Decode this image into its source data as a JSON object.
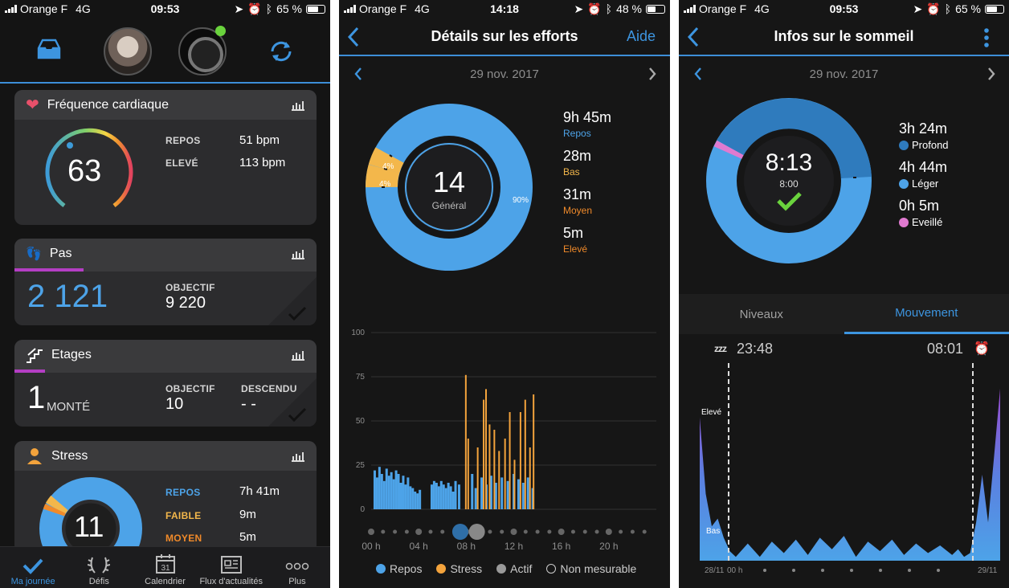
{
  "status": [
    {
      "carrier": "Orange F",
      "network": "4G",
      "time": "09:53",
      "battery": "65 %",
      "battery_level": 0.65
    },
    {
      "carrier": "Orange F",
      "network": "4G",
      "time": "14:18",
      "battery": "48 %",
      "battery_level": 0.48
    },
    {
      "carrier": "Orange F",
      "network": "4G",
      "time": "09:53",
      "battery": "65 %",
      "battery_level": 0.65
    }
  ],
  "day": {
    "heart": {
      "title": "Fréquence cardiaque",
      "value": "63",
      "rest_label": "REPOS",
      "rest_value": "51 bpm",
      "high_label": "ELEVÉ",
      "high_value": "113 bpm"
    },
    "steps": {
      "title": "Pas",
      "value": "2 121",
      "goal_label": "OBJECTIF",
      "goal_value": "9 220",
      "progress": 0.23
    },
    "floors": {
      "title": "Etages",
      "value": "1",
      "value_suffix": "MONTÉ",
      "goal_label": "OBJECTIF",
      "goal_value": "10",
      "down_label": "DESCENDU",
      "down_value": "- -",
      "progress": 0.1
    },
    "stress": {
      "title": "Stress",
      "value": "11",
      "rows": [
        {
          "label": "REPOS",
          "value": "7h 41m",
          "color": "#4da3e8"
        },
        {
          "label": "FAIBLE",
          "value": "9m",
          "color": "#f3b74b"
        },
        {
          "label": "MOYEN",
          "value": "5m",
          "color": "#f08a2a"
        }
      ]
    },
    "tabs": [
      {
        "label": "Ma journée",
        "icon": "check-icon"
      },
      {
        "label": "Défis",
        "icon": "laurel-icon"
      },
      {
        "label": "Calendrier",
        "icon": "calendar-icon",
        "day_number": "31"
      },
      {
        "label": "Flux d'actualités",
        "icon": "newsfeed-icon"
      },
      {
        "label": "Plus",
        "icon": "more-icon"
      }
    ]
  },
  "stress_detail": {
    "title": "Détails sur les efforts",
    "help": "Aide",
    "date": "29 nov. 2017",
    "score": "14",
    "score_label": "Général",
    "pct_labels": [
      "90%",
      "4%",
      "4%"
    ],
    "legend": [
      {
        "time": "9h 45m",
        "label": "Repos",
        "color": "#4da3e8"
      },
      {
        "time": "28m",
        "label": "Bas",
        "color": "#f3b74b"
      },
      {
        "time": "31m",
        "label": "Moyen",
        "color": "#f08a2a"
      },
      {
        "time": "5m",
        "label": "Elevé",
        "color": "#f08a2a"
      }
    ],
    "chart_legend": [
      {
        "label": "Repos",
        "color": "#4da3e8"
      },
      {
        "label": "Stress",
        "color": "#f3a33c"
      },
      {
        "label": "Actif",
        "color": "#9a9a9a"
      },
      {
        "label": "Non mesurable",
        "color": "none"
      }
    ]
  },
  "sleep": {
    "title": "Infos sur le sommeil",
    "date": "29 nov. 2017",
    "total": "8:13",
    "goal": "8:00",
    "legend": [
      {
        "time": "3h 24m",
        "label": "Profond",
        "color": "#2f7bbd"
      },
      {
        "time": "4h 44m",
        "label": "Léger",
        "color": "#4da3e8"
      },
      {
        "time": "0h 5m",
        "label": "Eveillé",
        "color": "#e07ad0"
      }
    ],
    "tabs": [
      "Niveaux",
      "Mouvement"
    ],
    "start": "23:48",
    "end": "08:01",
    "zzz": "zzz",
    "level_high": "Elevé",
    "level_low": "Bas"
  },
  "chart_data": [
    {
      "type": "bar",
      "title": "",
      "x": [
        "00 h",
        "04 h",
        "08 h",
        "12 h",
        "16 h",
        "20 h"
      ],
      "ylim": [
        0,
        100
      ],
      "yticks": [
        "0",
        "25",
        "50",
        "75",
        "100"
      ],
      "series": [
        {
          "name": "Repos",
          "color": "#4da3e8",
          "values": [
            {
              "t": 0.2,
              "v": 22
            },
            {
              "t": 0.4,
              "v": 18
            },
            {
              "t": 0.6,
              "v": 24
            },
            {
              "t": 0.8,
              "v": 20
            },
            {
              "t": 1.0,
              "v": 16
            },
            {
              "t": 1.2,
              "v": 23
            },
            {
              "t": 1.4,
              "v": 19
            },
            {
              "t": 1.6,
              "v": 21
            },
            {
              "t": 1.8,
              "v": 17
            },
            {
              "t": 2.0,
              "v": 22
            },
            {
              "t": 2.2,
              "v": 20
            },
            {
              "t": 2.4,
              "v": 15
            },
            {
              "t": 2.6,
              "v": 19
            },
            {
              "t": 2.8,
              "v": 14
            },
            {
              "t": 3.0,
              "v": 18
            },
            {
              "t": 3.2,
              "v": 13
            },
            {
              "t": 3.4,
              "v": 12
            },
            {
              "t": 3.6,
              "v": 10
            },
            {
              "t": 3.8,
              "v": 9
            },
            {
              "t": 4.0,
              "v": 11
            },
            {
              "t": 5.0,
              "v": 14
            },
            {
              "t": 5.2,
              "v": 16
            },
            {
              "t": 5.4,
              "v": 15
            },
            {
              "t": 5.6,
              "v": 13
            },
            {
              "t": 5.8,
              "v": 16
            },
            {
              "t": 6.0,
              "v": 14
            },
            {
              "t": 6.2,
              "v": 12
            },
            {
              "t": 6.4,
              "v": 15
            },
            {
              "t": 6.6,
              "v": 13
            },
            {
              "t": 6.8,
              "v": 10
            },
            {
              "t": 7.0,
              "v": 16
            },
            {
              "t": 7.3,
              "v": 14
            },
            {
              "t": 8.4,
              "v": 20
            },
            {
              "t": 8.7,
              "v": 12
            },
            {
              "t": 9.2,
              "v": 18
            },
            {
              "t": 9.6,
              "v": 14
            },
            {
              "t": 10.0,
              "v": 19
            },
            {
              "t": 10.4,
              "v": 15
            },
            {
              "t": 10.9,
              "v": 18
            },
            {
              "t": 11.4,
              "v": 16
            },
            {
              "t": 11.9,
              "v": 20
            },
            {
              "t": 12.3,
              "v": 17
            },
            {
              "t": 12.7,
              "v": 15
            },
            {
              "t": 13.1,
              "v": 18
            },
            {
              "t": 13.5,
              "v": 12
            }
          ]
        },
        {
          "name": "Stress",
          "color": "#f3a33c",
          "values": [
            {
              "t": 7.9,
              "v": 76
            },
            {
              "t": 8.1,
              "v": 40
            },
            {
              "t": 8.9,
              "v": 35
            },
            {
              "t": 9.4,
              "v": 62
            },
            {
              "t": 9.6,
              "v": 68
            },
            {
              "t": 9.9,
              "v": 48
            },
            {
              "t": 10.3,
              "v": 45
            },
            {
              "t": 10.7,
              "v": 33
            },
            {
              "t": 11.2,
              "v": 40
            },
            {
              "t": 11.6,
              "v": 55
            },
            {
              "t": 12.0,
              "v": 28
            },
            {
              "t": 12.5,
              "v": 55
            },
            {
              "t": 12.9,
              "v": 62
            },
            {
              "t": 13.3,
              "v": 35
            },
            {
              "t": 13.6,
              "v": 65
            }
          ]
        }
      ]
    },
    {
      "type": "area",
      "title": "",
      "x_start": "28/11",
      "x_start_hour": "00 h",
      "x_end": "29/11",
      "series": [
        {
          "name": "Mouvement",
          "values": [
            {
              "t": 0.0,
              "v": 0.75
            },
            {
              "t": 0.02,
              "v": 0.35
            },
            {
              "t": 0.04,
              "v": 0.18
            },
            {
              "t": 0.06,
              "v": 0.22
            },
            {
              "t": 0.08,
              "v": 0.12
            },
            {
              "t": 0.1,
              "v": 0.05
            },
            {
              "t": 0.12,
              "v": 0.02
            },
            {
              "t": 0.16,
              "v": 0.09
            },
            {
              "t": 0.2,
              "v": 0.02
            },
            {
              "t": 0.24,
              "v": 0.1
            },
            {
              "t": 0.28,
              "v": 0.04
            },
            {
              "t": 0.32,
              "v": 0.11
            },
            {
              "t": 0.36,
              "v": 0.03
            },
            {
              "t": 0.4,
              "v": 0.12
            },
            {
              "t": 0.44,
              "v": 0.06
            },
            {
              "t": 0.48,
              "v": 0.13
            },
            {
              "t": 0.52,
              "v": 0.02
            },
            {
              "t": 0.56,
              "v": 0.1
            },
            {
              "t": 0.6,
              "v": 0.05
            },
            {
              "t": 0.64,
              "v": 0.11
            },
            {
              "t": 0.68,
              "v": 0.03
            },
            {
              "t": 0.72,
              "v": 0.09
            },
            {
              "t": 0.76,
              "v": 0.04
            },
            {
              "t": 0.8,
              "v": 0.08
            },
            {
              "t": 0.84,
              "v": 0.03
            },
            {
              "t": 0.86,
              "v": 0.06
            },
            {
              "t": 0.88,
              "v": 0.02
            },
            {
              "t": 0.9,
              "v": 0.04
            },
            {
              "t": 0.92,
              "v": 0.2
            },
            {
              "t": 0.94,
              "v": 0.45
            },
            {
              "t": 0.96,
              "v": 0.2
            },
            {
              "t": 0.98,
              "v": 0.55
            },
            {
              "t": 1.0,
              "v": 0.9
            }
          ]
        }
      ]
    }
  ]
}
